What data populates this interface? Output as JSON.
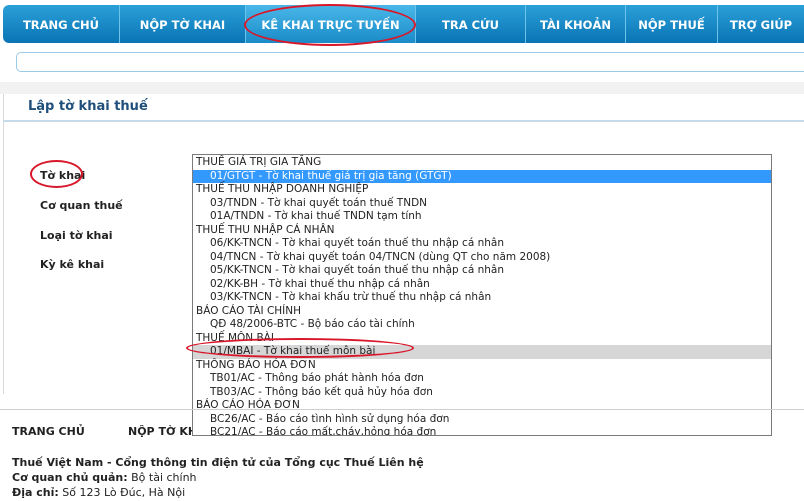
{
  "nav": {
    "items": [
      {
        "label": "TRANG CHỦ"
      },
      {
        "label": "NỘP TỜ KHAI"
      },
      {
        "label": "KÊ KHAI TRỰC TUYẾN"
      },
      {
        "label": "TRA CỨU"
      },
      {
        "label": "TÀI KHOẢN"
      },
      {
        "label": "NỘP THUẾ"
      },
      {
        "label": "TRỢ GIÚP"
      }
    ],
    "active_index": 2
  },
  "panel": {
    "title": "Lập tờ khai thuế"
  },
  "form": {
    "labels": {
      "to_khai": "Tờ khai",
      "co_quan_thue": "Cơ quan thuế",
      "loai_to_khai": "Loại tờ khai",
      "ky_ke_khai": "Kỳ kê khai"
    }
  },
  "dropdown": {
    "options": [
      {
        "kind": "group",
        "text": "THUẾ GIÁ TRỊ GIA TĂNG"
      },
      {
        "kind": "item",
        "text": "01/GTGT - Tờ khai thuế giá trị gia tăng (GTGT)",
        "selected": true
      },
      {
        "kind": "group",
        "text": "THUẾ THU NHẬP DOANH NGHIỆP"
      },
      {
        "kind": "item",
        "text": "03/TNDN - Tờ khai quyết toán thuế TNDN"
      },
      {
        "kind": "item",
        "text": "01A/TNDN - Tờ khai thuế TNDN tạm tính"
      },
      {
        "kind": "group",
        "text": "THUẾ THU NHẬP CÁ NHÂN"
      },
      {
        "kind": "item",
        "text": "06/KK-TNCN - Tờ khai quyết toán thuế thu nhập cá nhân"
      },
      {
        "kind": "item",
        "text": "04/TNCN - Tờ khai quyết toán 04/TNCN (dùng QT cho năm 2008)"
      },
      {
        "kind": "item",
        "text": "05/KK-TNCN - Tờ khai quyết toán thuế thu nhập cá nhân"
      },
      {
        "kind": "item",
        "text": "02/KK-BH - Tờ khai thuế thu nhập cá nhân"
      },
      {
        "kind": "item",
        "text": "03/KK-TNCN - Tờ khai khấu trừ thuế thu nhập cá nhân"
      },
      {
        "kind": "group",
        "text": "BÁO CÁO TÀI CHÍNH"
      },
      {
        "kind": "item",
        "text": "QĐ 48/2006-BTC - Bộ báo cáo tài chính"
      },
      {
        "kind": "group",
        "text": "THUẾ MÔN BÀI"
      },
      {
        "kind": "item",
        "text": "01/MBAI - Tờ khai thuế môn bài",
        "hover": true
      },
      {
        "kind": "group",
        "text": "THÔNG BÁO HÓA ĐƠN"
      },
      {
        "kind": "item",
        "text": "TB01/AC - Thông báo phát hành hóa đơn"
      },
      {
        "kind": "item",
        "text": "TB03/AC - Thông báo kết quả hủy hóa đơn"
      },
      {
        "kind": "group",
        "text": "BÁO CÁO HÓA ĐƠN"
      },
      {
        "kind": "item",
        "text": "BC26/AC - Báo cáo tình hình sử dụng hóa đơn"
      },
      {
        "kind": "item",
        "text": "BC21/AC - Báo cáo mất,cháy,hỏng hóa đơn"
      }
    ]
  },
  "footer": {
    "nav": [
      "TRANG CHỦ",
      "NỘP TỜ KH"
    ],
    "line1": "Thuế Việt Nam - Cổng thông tin điện tử của Tổng cục Thuế Liên hệ",
    "line2_label": "Cơ quan chủ quản:",
    "line2_value": "Bộ tài chính",
    "line3_label": "Địa chỉ:",
    "line3_value": "Số 123 Lò Đúc, Hà Nội"
  },
  "colors": {
    "nav_blue": "#0a74b4",
    "highlight_red": "#d8182a",
    "selected_blue": "#3399ff",
    "title_blue": "#1f4f7a"
  }
}
